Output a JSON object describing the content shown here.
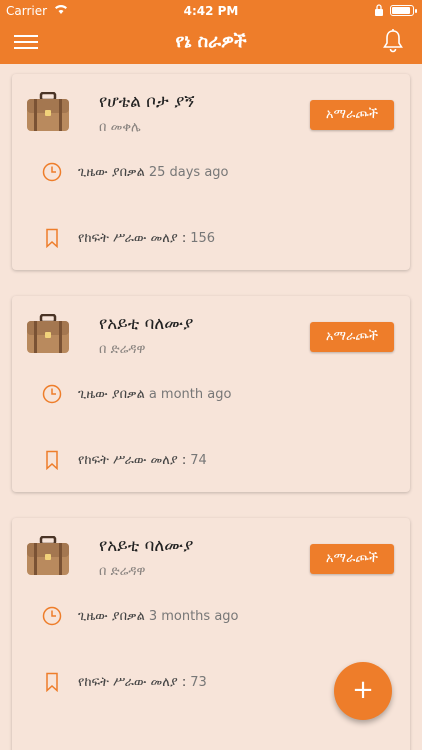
{
  "status": {
    "carrier": "Carrier",
    "time": "4:42 PM",
    "battery_level": 0.9
  },
  "header": {
    "title": "የኔ ስራዎች"
  },
  "colors": {
    "accent": "#ee7d2a",
    "background": "#f7e4d9"
  },
  "jobs": [
    {
      "title": "የሆቴል ቦታ ያኝ",
      "location": "በ መቀሌ",
      "badge": "አማራጮች",
      "posted_label": "ጊዜው ያበቃል",
      "posted_value": "25 days ago",
      "count_label": "የከፍት ሥራው መለያ :",
      "count_value": "156"
    },
    {
      "title": "የአይቲ ባለሙያ",
      "location": "በ ድሬዳዋ",
      "badge": "አማራጮች",
      "posted_label": "ጊዜው ያበቃል",
      "posted_value": "a month ago",
      "count_label": "የከፍት ሥራው መለያ :",
      "count_value": "74"
    },
    {
      "title": "የአይቲ ባለሙያ",
      "location": "በ ድሬዳዋ",
      "badge": "አማራጮች",
      "posted_label": "ጊዜው ያበቃል",
      "posted_value": "3 months ago",
      "count_label": "የከፍት ሥራው መለያ :",
      "count_value": "73"
    }
  ],
  "fab": {
    "label": "+"
  }
}
